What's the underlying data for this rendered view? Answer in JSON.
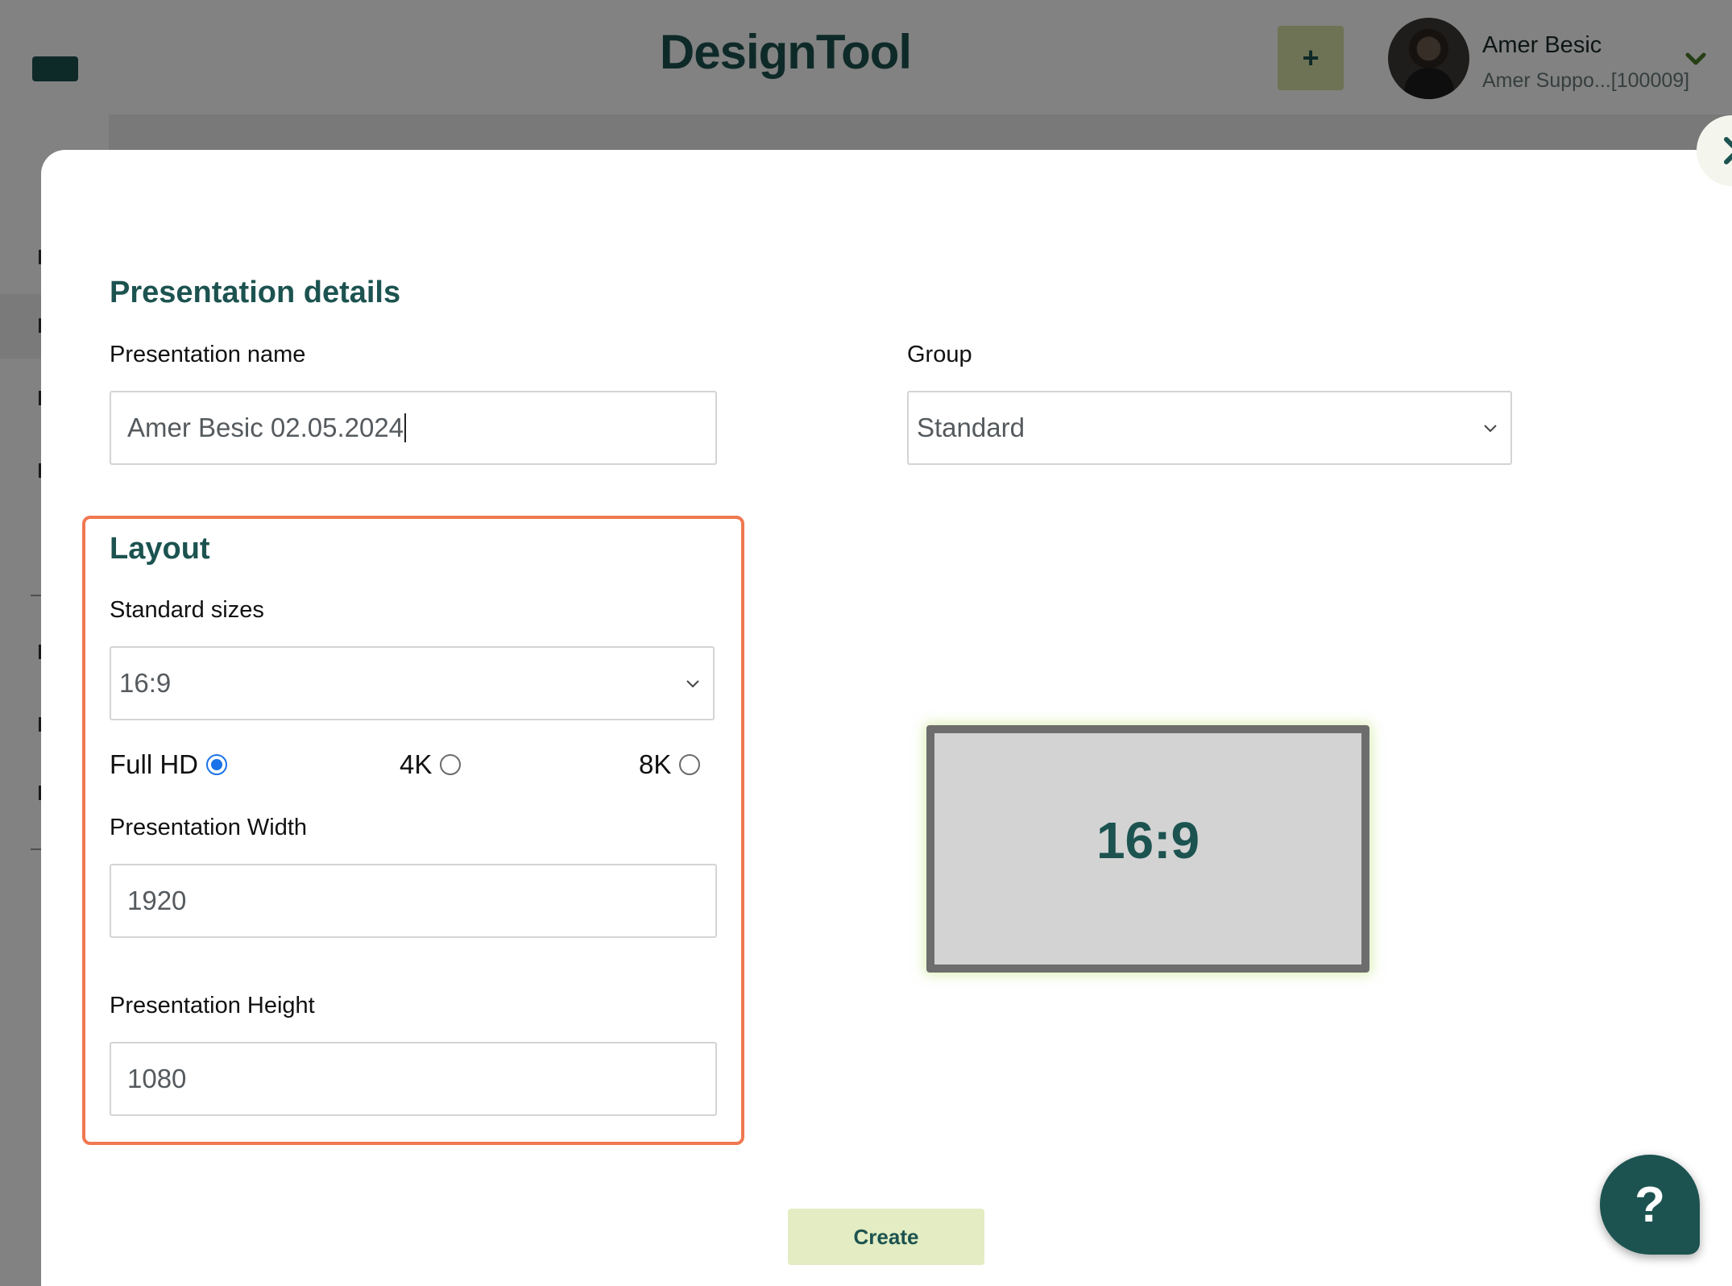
{
  "header": {
    "app_title": "DesignTool",
    "add_button_label": "+",
    "user_name": "Amer Besic",
    "user_account": "Amer Suppo...[100009]"
  },
  "modal": {
    "details_title": "Presentation details",
    "name_label": "Presentation name",
    "name_value": "Amer Besic 02.05.2024",
    "group_label": "Group",
    "group_value": "Standard",
    "layout_title": "Layout",
    "standard_sizes_label": "Standard sizes",
    "standard_sizes_value": "16:9",
    "resolutions": [
      {
        "label": "Full HD",
        "checked": true
      },
      {
        "label": "4K",
        "checked": false
      },
      {
        "label": "8K",
        "checked": false
      }
    ],
    "width_label": "Presentation Width",
    "width_value": "1920",
    "height_label": "Presentation Height",
    "height_value": "1080",
    "preview_ratio": "16:9",
    "create_button": "Create"
  },
  "help_button": "?",
  "icons": {
    "close": "chevron-right-icon",
    "select": "chevron-down-icon",
    "user_menu": "chevron-down-icon"
  },
  "colors": {
    "brand": "#1c5350",
    "accent_light": "#e3ecc2",
    "layout_border": "#f07850",
    "radio_selected": "#1a73e8"
  }
}
